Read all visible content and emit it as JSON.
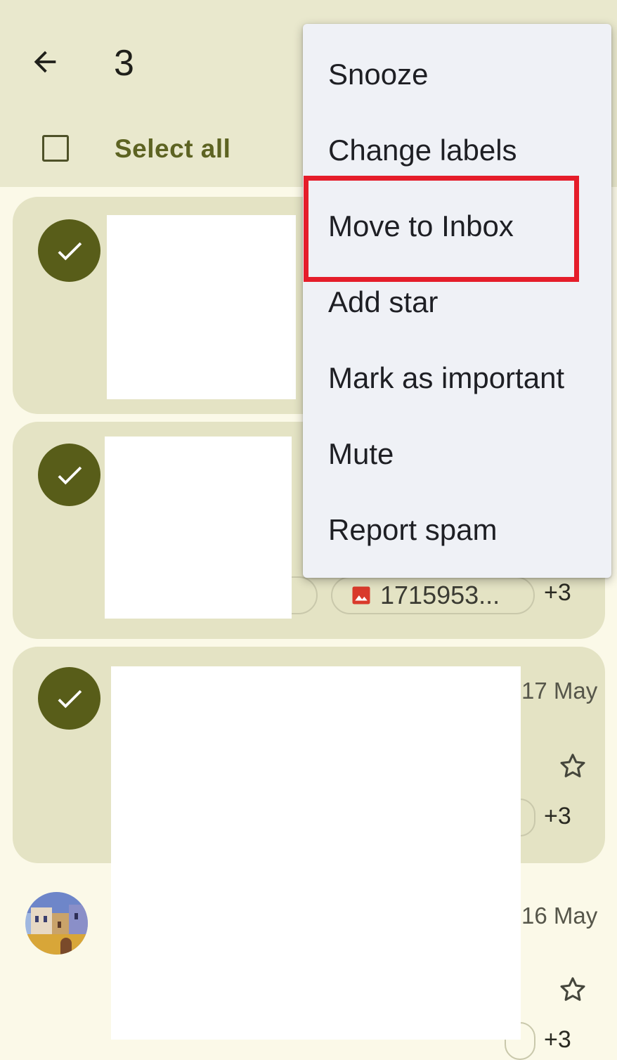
{
  "header": {
    "selected_count": "3",
    "select_all_label": "Select all"
  },
  "menu": {
    "items": [
      {
        "label": "Snooze"
      },
      {
        "label": "Change labels"
      },
      {
        "label": "Move to Inbox"
      },
      {
        "label": "Add star"
      },
      {
        "label": "Mark as important"
      },
      {
        "label": "Mute"
      },
      {
        "label": "Report spam"
      }
    ],
    "highlighted_item": "Move to Inbox",
    "highlight_color": "#e51d2a"
  },
  "emails": [
    {
      "selected": true
    },
    {
      "selected": true,
      "attachment_name": "1715953...",
      "more_attachments": "+3",
      "attachment_icon": "image-icon"
    },
    {
      "selected": true,
      "date": "17 May",
      "more_attachments": "+3",
      "starred": false
    },
    {
      "selected": false,
      "date": "16 May",
      "more_attachments": "+3",
      "starred": false,
      "avatar": "photo-avatar"
    }
  ],
  "colors": {
    "appbar": "#e9e8cd",
    "background": "#fbf9e8",
    "selected_card": "#e4e3c4",
    "check_circle": "#585d19",
    "select_all_text": "#5d6322",
    "menu_bg": "#eff1f6"
  }
}
